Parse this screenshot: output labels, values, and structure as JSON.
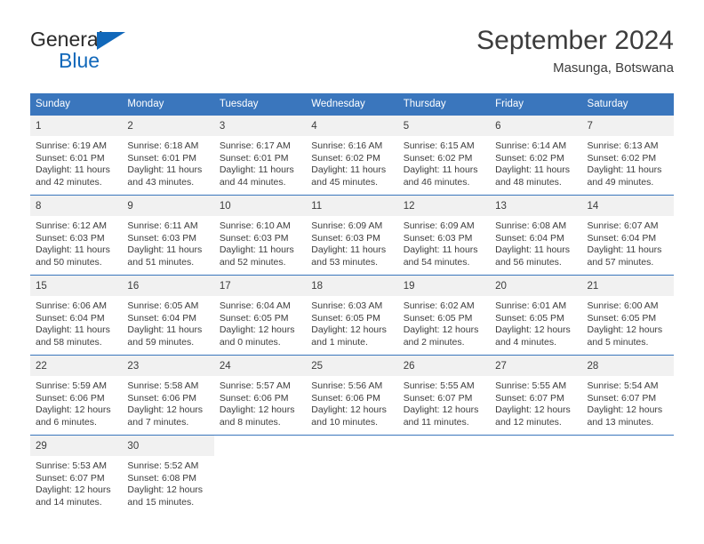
{
  "brand": {
    "name_top": "General",
    "name_bottom": "Blue",
    "logo_icon": "blue-triangle-logo"
  },
  "header": {
    "title": "September 2024",
    "subtitle": "Masunga, Botswana"
  },
  "colors": {
    "header_blue": "#3a76bd",
    "brand_blue": "#1168ba",
    "daynum_band": "#f1f1f1",
    "text": "#3c3c3c"
  },
  "calendar": {
    "weekdays": [
      "Sunday",
      "Monday",
      "Tuesday",
      "Wednesday",
      "Thursday",
      "Friday",
      "Saturday"
    ],
    "weeks": [
      [
        {
          "day": "1",
          "sunrise": "Sunrise: 6:19 AM",
          "sunset": "Sunset: 6:01 PM",
          "daylight": "Daylight: 11 hours and 42 minutes."
        },
        {
          "day": "2",
          "sunrise": "Sunrise: 6:18 AM",
          "sunset": "Sunset: 6:01 PM",
          "daylight": "Daylight: 11 hours and 43 minutes."
        },
        {
          "day": "3",
          "sunrise": "Sunrise: 6:17 AM",
          "sunset": "Sunset: 6:01 PM",
          "daylight": "Daylight: 11 hours and 44 minutes."
        },
        {
          "day": "4",
          "sunrise": "Sunrise: 6:16 AM",
          "sunset": "Sunset: 6:02 PM",
          "daylight": "Daylight: 11 hours and 45 minutes."
        },
        {
          "day": "5",
          "sunrise": "Sunrise: 6:15 AM",
          "sunset": "Sunset: 6:02 PM",
          "daylight": "Daylight: 11 hours and 46 minutes."
        },
        {
          "day": "6",
          "sunrise": "Sunrise: 6:14 AM",
          "sunset": "Sunset: 6:02 PM",
          "daylight": "Daylight: 11 hours and 48 minutes."
        },
        {
          "day": "7",
          "sunrise": "Sunrise: 6:13 AM",
          "sunset": "Sunset: 6:02 PM",
          "daylight": "Daylight: 11 hours and 49 minutes."
        }
      ],
      [
        {
          "day": "8",
          "sunrise": "Sunrise: 6:12 AM",
          "sunset": "Sunset: 6:03 PM",
          "daylight": "Daylight: 11 hours and 50 minutes."
        },
        {
          "day": "9",
          "sunrise": "Sunrise: 6:11 AM",
          "sunset": "Sunset: 6:03 PM",
          "daylight": "Daylight: 11 hours and 51 minutes."
        },
        {
          "day": "10",
          "sunrise": "Sunrise: 6:10 AM",
          "sunset": "Sunset: 6:03 PM",
          "daylight": "Daylight: 11 hours and 52 minutes."
        },
        {
          "day": "11",
          "sunrise": "Sunrise: 6:09 AM",
          "sunset": "Sunset: 6:03 PM",
          "daylight": "Daylight: 11 hours and 53 minutes."
        },
        {
          "day": "12",
          "sunrise": "Sunrise: 6:09 AM",
          "sunset": "Sunset: 6:03 PM",
          "daylight": "Daylight: 11 hours and 54 minutes."
        },
        {
          "day": "13",
          "sunrise": "Sunrise: 6:08 AM",
          "sunset": "Sunset: 6:04 PM",
          "daylight": "Daylight: 11 hours and 56 minutes."
        },
        {
          "day": "14",
          "sunrise": "Sunrise: 6:07 AM",
          "sunset": "Sunset: 6:04 PM",
          "daylight": "Daylight: 11 hours and 57 minutes."
        }
      ],
      [
        {
          "day": "15",
          "sunrise": "Sunrise: 6:06 AM",
          "sunset": "Sunset: 6:04 PM",
          "daylight": "Daylight: 11 hours and 58 minutes."
        },
        {
          "day": "16",
          "sunrise": "Sunrise: 6:05 AM",
          "sunset": "Sunset: 6:04 PM",
          "daylight": "Daylight: 11 hours and 59 minutes."
        },
        {
          "day": "17",
          "sunrise": "Sunrise: 6:04 AM",
          "sunset": "Sunset: 6:05 PM",
          "daylight": "Daylight: 12 hours and 0 minutes."
        },
        {
          "day": "18",
          "sunrise": "Sunrise: 6:03 AM",
          "sunset": "Sunset: 6:05 PM",
          "daylight": "Daylight: 12 hours and 1 minute."
        },
        {
          "day": "19",
          "sunrise": "Sunrise: 6:02 AM",
          "sunset": "Sunset: 6:05 PM",
          "daylight": "Daylight: 12 hours and 2 minutes."
        },
        {
          "day": "20",
          "sunrise": "Sunrise: 6:01 AM",
          "sunset": "Sunset: 6:05 PM",
          "daylight": "Daylight: 12 hours and 4 minutes."
        },
        {
          "day": "21",
          "sunrise": "Sunrise: 6:00 AM",
          "sunset": "Sunset: 6:05 PM",
          "daylight": "Daylight: 12 hours and 5 minutes."
        }
      ],
      [
        {
          "day": "22",
          "sunrise": "Sunrise: 5:59 AM",
          "sunset": "Sunset: 6:06 PM",
          "daylight": "Daylight: 12 hours and 6 minutes."
        },
        {
          "day": "23",
          "sunrise": "Sunrise: 5:58 AM",
          "sunset": "Sunset: 6:06 PM",
          "daylight": "Daylight: 12 hours and 7 minutes."
        },
        {
          "day": "24",
          "sunrise": "Sunrise: 5:57 AM",
          "sunset": "Sunset: 6:06 PM",
          "daylight": "Daylight: 12 hours and 8 minutes."
        },
        {
          "day": "25",
          "sunrise": "Sunrise: 5:56 AM",
          "sunset": "Sunset: 6:06 PM",
          "daylight": "Daylight: 12 hours and 10 minutes."
        },
        {
          "day": "26",
          "sunrise": "Sunrise: 5:55 AM",
          "sunset": "Sunset: 6:07 PM",
          "daylight": "Daylight: 12 hours and 11 minutes."
        },
        {
          "day": "27",
          "sunrise": "Sunrise: 5:55 AM",
          "sunset": "Sunset: 6:07 PM",
          "daylight": "Daylight: 12 hours and 12 minutes."
        },
        {
          "day": "28",
          "sunrise": "Sunrise: 5:54 AM",
          "sunset": "Sunset: 6:07 PM",
          "daylight": "Daylight: 12 hours and 13 minutes."
        }
      ],
      [
        {
          "day": "29",
          "sunrise": "Sunrise: 5:53 AM",
          "sunset": "Sunset: 6:07 PM",
          "daylight": "Daylight: 12 hours and 14 minutes."
        },
        {
          "day": "30",
          "sunrise": "Sunrise: 5:52 AM",
          "sunset": "Sunset: 6:08 PM",
          "daylight": "Daylight: 12 hours and 15 minutes."
        },
        {
          "day": "",
          "sunrise": "",
          "sunset": "",
          "daylight": ""
        },
        {
          "day": "",
          "sunrise": "",
          "sunset": "",
          "daylight": ""
        },
        {
          "day": "",
          "sunrise": "",
          "sunset": "",
          "daylight": ""
        },
        {
          "day": "",
          "sunrise": "",
          "sunset": "",
          "daylight": ""
        },
        {
          "day": "",
          "sunrise": "",
          "sunset": "",
          "daylight": ""
        }
      ]
    ]
  }
}
